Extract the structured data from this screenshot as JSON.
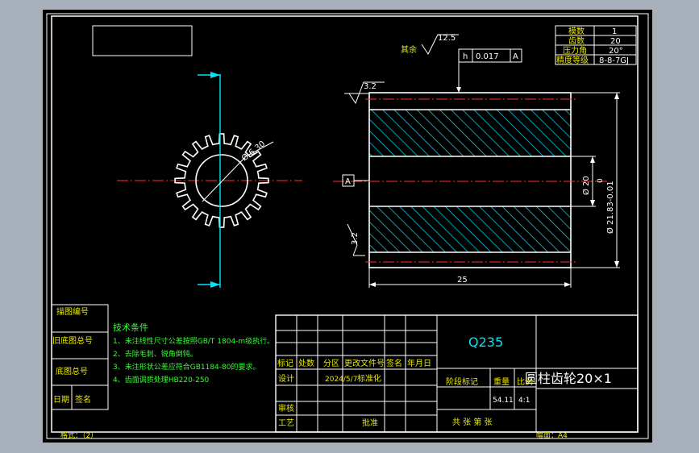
{
  "gear_params": {
    "rows": [
      {
        "label": "模数",
        "value": "1"
      },
      {
        "label": "齿数",
        "value": "20"
      },
      {
        "label": "压力角",
        "value": "20°"
      },
      {
        "label": "精度等级",
        "value": "8-8-7GJ"
      }
    ]
  },
  "roughness": {
    "rest_label": "其余",
    "rest_value": "12.5",
    "face_value": "3.2",
    "face_value_2": "3.2"
  },
  "tolerance_frame": {
    "symbol": "h",
    "value": "0.017",
    "datum": "A"
  },
  "datum_label": "A",
  "dimensions": {
    "bore": "Ø 6.30",
    "length": "25",
    "hub_dia": "Ø 20",
    "outer_dia": "Ø 21.83-0.01",
    "outer_upper": "0"
  },
  "tech_requirements": {
    "title": "技术条件",
    "items": [
      "1、未注线性尺寸公差按照GB/T 1804-m级执行。",
      "2、去除毛刺、锐角倒钝。",
      "3、未注形状公差应符合GB1184-80的要求。",
      "4、齿面调质处理HB220-250"
    ]
  },
  "side_labels": [
    "描图编号",
    "旧底图总号",
    "底图总号",
    "日期",
    "签名"
  ],
  "title_block": {
    "material": "Q235",
    "part_name": "圆柱齿轮20×1",
    "header_cells": [
      "标记",
      "处数",
      "分区",
      "更改文件号",
      "签名",
      "年月日"
    ],
    "design_label": "设计",
    "design_date": "2024/5/7",
    "standardize_label": "标准化",
    "stage_label": "阶段标记",
    "weight_label": "重量",
    "scale_label": "比例",
    "weight_value": "54.11",
    "scale_value": "4:1",
    "review_label": "审核",
    "process_label": "工艺",
    "approve_label": "批准",
    "sheets_text": "共   张   第   张"
  },
  "footer": {
    "format_label": "格式：（2）",
    "paper_label": "幅面：A4"
  }
}
